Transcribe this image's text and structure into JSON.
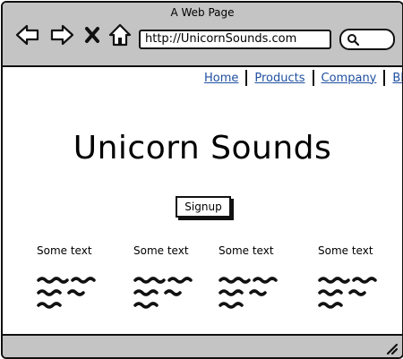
{
  "window": {
    "title": "A Web Page"
  },
  "toolbar": {
    "back_icon": "back-arrow-icon",
    "forward_icon": "forward-arrow-icon",
    "stop_icon": "close-x-icon",
    "home_icon": "home-icon",
    "url": "http://UnicornSounds.com",
    "search_icon": "search-icon"
  },
  "nav": {
    "links": [
      "Home",
      "Products",
      "Company",
      "Blog"
    ]
  },
  "hero": {
    "title": "Unicorn Sounds",
    "signup_label": "Signup"
  },
  "columns": [
    {
      "title": "Some text"
    },
    {
      "title": "Some text"
    },
    {
      "title": "Some text"
    },
    {
      "title": "Some text"
    }
  ],
  "colors": {
    "chrome": "#c4c4c4",
    "link": "#1f4fa0",
    "ink": "#111111"
  }
}
